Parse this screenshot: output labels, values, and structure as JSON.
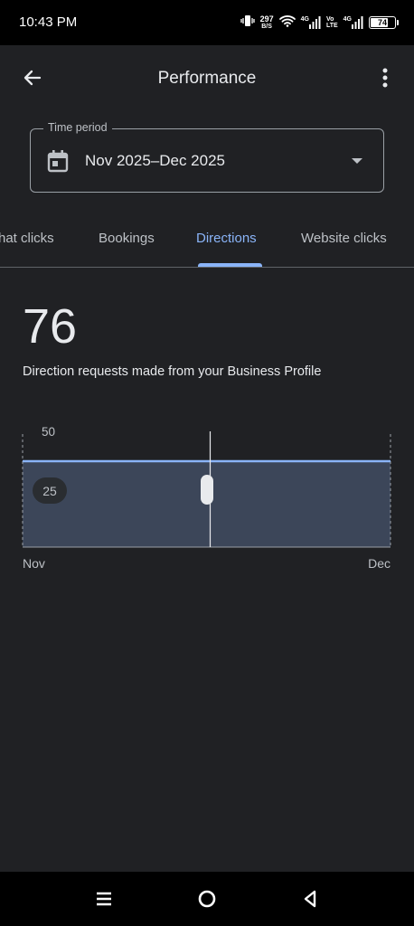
{
  "status_bar": {
    "time": "10:43 PM",
    "net_speed_value": "297",
    "net_speed_unit": "B/S",
    "signal1_label": "4G",
    "volte_top": "Vo",
    "volte_bottom": "LTE",
    "signal2_label": "4G",
    "battery_level": "74",
    "battery_fraction": 0.74,
    "icons": [
      "vibrate-icon",
      "wifi-icon",
      "cellular-signal-icon",
      "cellular-signal-icon",
      "battery-icon"
    ]
  },
  "app_bar": {
    "title": "Performance",
    "back_icon": "arrow-back-icon",
    "menu_icon": "more-vert-icon"
  },
  "time_period": {
    "label": "Time period",
    "value": "Nov 2025–Dec 2025",
    "icon": "calendar-icon",
    "dropdown_icon": "arrow-drop-down-icon"
  },
  "tabs": [
    {
      "label": "hat clicks",
      "active": false
    },
    {
      "label": "Bookings",
      "active": false
    },
    {
      "label": "Directions",
      "active": true
    },
    {
      "label": "Website clicks",
      "active": false
    }
  ],
  "metric": {
    "value": "76",
    "description": "Direction requests made from your Business Profile"
  },
  "chart_data": {
    "type": "area",
    "x": [
      "Nov",
      "Dec"
    ],
    "series": [
      {
        "values": [
          38,
          38
        ]
      }
    ],
    "y_ticks": [
      "50",
      "25"
    ],
    "x_tick_labels": [
      "Nov",
      "Dec"
    ],
    "ylim": [
      0,
      50
    ],
    "cursor_at": "mid",
    "line_color": "#8ab4f8",
    "fill_color": "#3c4659"
  },
  "colors": {
    "background": "#202124",
    "accent": "#8ab4f8",
    "text": "#e8eaed",
    "muted": "#bdc1c6"
  },
  "nav_bar": {
    "icons": [
      "recents-menu-icon",
      "home-circle-icon",
      "back-triangle-icon"
    ]
  }
}
